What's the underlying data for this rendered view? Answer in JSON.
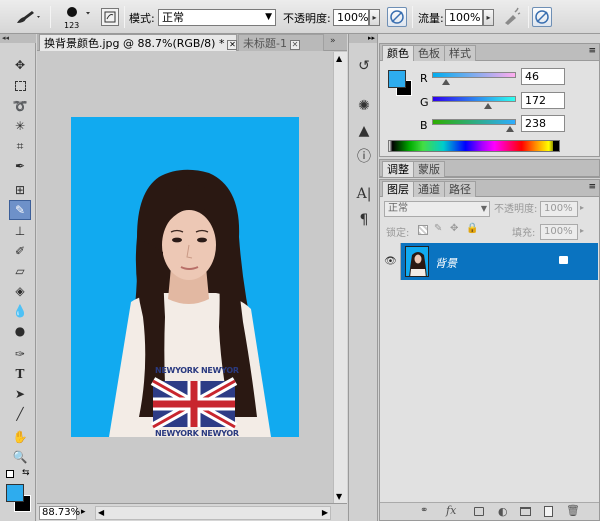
{
  "options_bar": {
    "brush_size": "123",
    "mode_label": "模式:",
    "mode_value": "正常",
    "opacity_label": "不透明度:",
    "opacity_value": "100%",
    "flow_label": "流量:",
    "flow_value": "100%"
  },
  "document": {
    "tab_active": "换背景颜色.jpg @ 88.7%(RGB/8) *",
    "tab_inactive": "未标题-1",
    "zoom": "88.73%"
  },
  "color_panel": {
    "tabs": [
      "颜色",
      "色板",
      "样式"
    ],
    "channels": [
      {
        "label": "R",
        "value": "46"
      },
      {
        "label": "G",
        "value": "172"
      },
      {
        "label": "B",
        "value": "238"
      }
    ],
    "foreground_color": "#2eacee",
    "background_color": "#000000"
  },
  "adjust_panel": {
    "tabs": [
      "调整",
      "蒙版"
    ]
  },
  "layers_panel": {
    "tabs": [
      "图层",
      "通道",
      "路径"
    ],
    "blend_mode": "正常",
    "opacity_label": "不透明度:",
    "opacity_value": "100%",
    "lock_label": "锁定:",
    "fill_label": "填充:",
    "fill_value": "100%",
    "layer_name": "背景"
  },
  "shirt_text": {
    "top": "NEWYORK NEWYOR",
    "bottom": "NEWYORK NEWYOR"
  },
  "colors": {
    "canvas_bg": "#11aaf0",
    "selection_blue": "#0a73c0"
  }
}
